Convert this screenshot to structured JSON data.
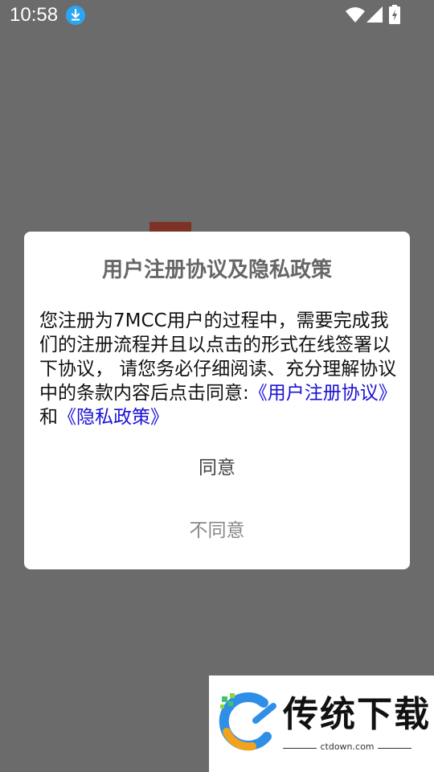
{
  "status_bar": {
    "time": "10:58",
    "icons": [
      "download-icon",
      "wifi-icon",
      "signal-icon",
      "battery-icon"
    ]
  },
  "dialog": {
    "title": "用户注册协议及隐私政策",
    "body_text": "您注册为7MCC用户的过程中，需要完成我们的注册流程并且以点击的形式在线签署以下协议， 请您务必仔细阅读、充分理解协议中的条款内容后点击同意:",
    "user_agreement_link": "《用户注册协议》",
    "conjunction": "和",
    "privacy_policy_link": "《隐私政策》",
    "agree_label": "同意",
    "disagree_label": "不同意"
  },
  "watermark": {
    "title": "传统下载",
    "subtitle": "ctdown.com"
  },
  "colors": {
    "overlay": "#6b6b6b",
    "link": "#1a12d6",
    "title": "#666666"
  }
}
